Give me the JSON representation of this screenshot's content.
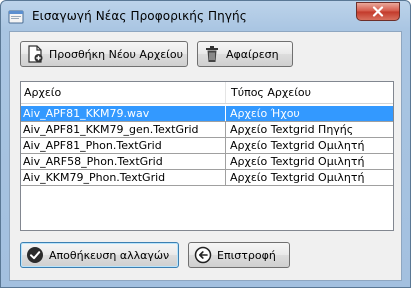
{
  "window": {
    "title": "Εισαγωγή Νέας Προφορικής Πηγής"
  },
  "toolbar": {
    "add_label": "Προσθήκη Νέου Αρχείου",
    "remove_label": "Αφαίρεση"
  },
  "table": {
    "columns": [
      "Αρχείο",
      "Τύπος Αρχείου"
    ],
    "rows": [
      {
        "file": "Aiv_APF81_KKM79.wav",
        "type": "Αρχείο Ήχου",
        "selected": true
      },
      {
        "file": "Aiv_APF81_KKM79_gen.TextGrid",
        "type": "Αρχείο Textgrid Πηγής",
        "selected": false
      },
      {
        "file": "Aiv_APF81_Phon.TextGrid",
        "type": "Αρχείο Textgrid Ομιλητή",
        "selected": false
      },
      {
        "file": "Aiv_ARF58_Phon.TextGrid",
        "type": "Αρχείο Textgrid Ομιλητή",
        "selected": false
      },
      {
        "file": "Aiv_KKM79_Phon.TextGrid",
        "type": "Αρχείο Textgrid Ομιλητή",
        "selected": false
      }
    ]
  },
  "footer": {
    "save_label": "Αποθήκευση αλλαγών",
    "back_label": "Επιστροφή"
  },
  "icons": {
    "app": "app-window-icon",
    "close": "close-icon",
    "add": "add-file-icon",
    "remove": "trash-icon",
    "save": "checkmark-icon",
    "back": "back-arrow-icon"
  },
  "colors": {
    "selection": "#3399ff",
    "close_button": "#c9483a"
  }
}
